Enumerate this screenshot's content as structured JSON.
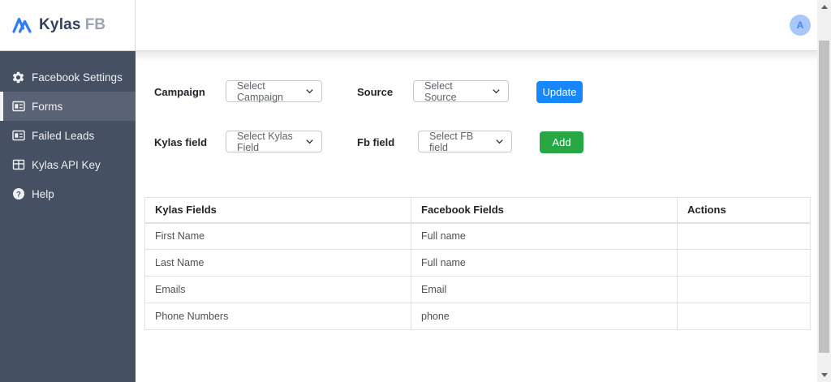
{
  "colors": {
    "primary_blue": "#1787ff",
    "success_green": "#28a745",
    "sidebar_bg": "#455063",
    "sidebar_active_bg": "#5a6375",
    "logo_blue": "#2e7cf6",
    "brand_text": "#33415c",
    "brand_suffix_gray": "#9aa5b1",
    "avatar_bg": "#a8c7fa",
    "avatar_text": "#4285f4",
    "table_border": "#dee2e6"
  },
  "header": {
    "brand": "Kylas",
    "brand_suffix": "FB",
    "avatar_letter": "A"
  },
  "sidebar": {
    "items": [
      {
        "label": "Facebook Settings",
        "icon": "gear-icon",
        "active": false
      },
      {
        "label": "Forms",
        "icon": "form-card-icon",
        "active": true
      },
      {
        "label": "Failed Leads",
        "icon": "form-card-icon",
        "active": false
      },
      {
        "label": "Kylas API Key",
        "icon": "table-grid-icon",
        "active": false
      },
      {
        "label": "Help",
        "icon": "help-circle-icon",
        "active": false
      }
    ]
  },
  "controls": {
    "campaign_label": "Campaign",
    "campaign_value": "Select Campaign",
    "source_label": "Source",
    "source_value": "Select Source",
    "update_button": "Update",
    "kylas_field_label": "Kylas field",
    "kylas_field_value": "Select Kylas Field",
    "fb_field_label": "Fb field",
    "fb_field_value": "Select FB field",
    "add_button": "Add"
  },
  "table": {
    "columns": [
      "Kylas Fields",
      "Facebook Fields",
      "Actions"
    ],
    "rows": [
      {
        "kylas_field": "First Name",
        "facebook_field": "Full name",
        "actions": ""
      },
      {
        "kylas_field": "Last Name",
        "facebook_field": "Full name",
        "actions": ""
      },
      {
        "kylas_field": "Emails",
        "facebook_field": "Email",
        "actions": ""
      },
      {
        "kylas_field": "Phone Numbers",
        "facebook_field": "phone",
        "actions": ""
      }
    ]
  }
}
